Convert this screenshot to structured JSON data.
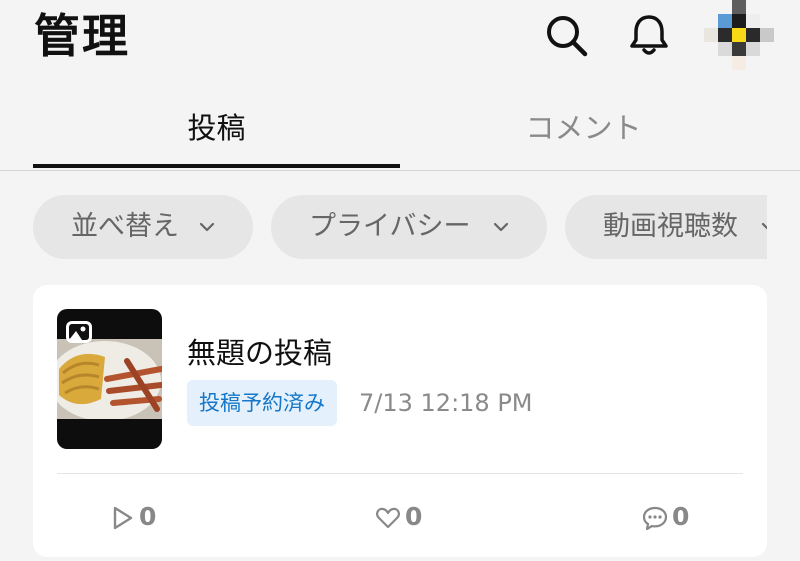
{
  "header": {
    "title": "管理",
    "icons": {
      "search": "search-icon",
      "notifications": "bell-icon",
      "avatar": "avatar"
    }
  },
  "tabs": [
    {
      "label": "投稿",
      "active": true
    },
    {
      "label": "コメント",
      "active": false
    }
  ],
  "filters": [
    {
      "label": "並べ替え",
      "icon": "chevron-down-icon"
    },
    {
      "label": "プライバシー",
      "icon": "chevron-down-icon"
    },
    {
      "label": "動画視聴数",
      "icon": "chevron-down-icon"
    }
  ],
  "post": {
    "title": "無題の投稿",
    "status": "投稿予約済み",
    "date": "7/13 12:18 PM",
    "type_icon": "image-icon",
    "stats": {
      "views": "0",
      "likes": "0",
      "comments": "0"
    }
  },
  "colors": {
    "background": "#f4f4f4",
    "status_badge_bg": "#e4f1fc",
    "status_badge_text": "#1677c8",
    "muted_text": "#8a8a8a"
  }
}
